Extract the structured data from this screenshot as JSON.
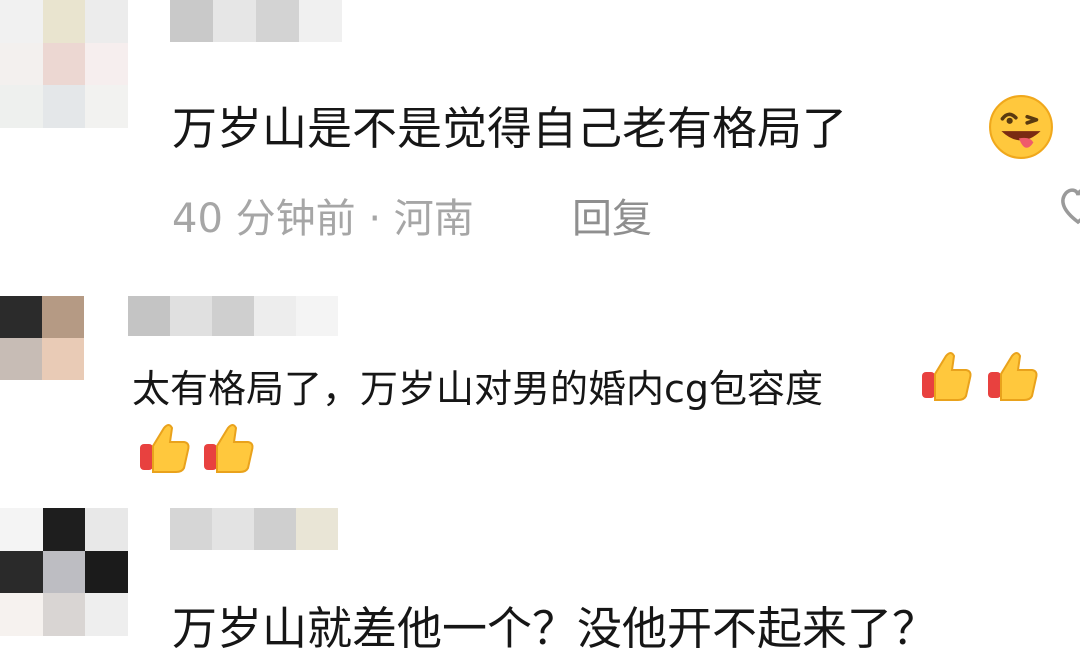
{
  "comments": [
    {
      "text": "万岁山是不是觉得自己老有格局了",
      "emoji": "grinning-tongue-wink-emoji",
      "meta": "40 分钟前 · 河南",
      "reply_label": "回复"
    },
    {
      "text": "太有格局了，万岁山对男的婚内cg包容度",
      "emoji": "thumbs-up-emoji"
    },
    {
      "text": "万岁山就差他一个？没他开不起来了？"
    }
  ],
  "icons": {
    "like": "heart-outline-icon"
  },
  "colors": {
    "text": "#161616",
    "meta": "#a6a6a6",
    "emoji_yellow": "#ffc83d"
  }
}
